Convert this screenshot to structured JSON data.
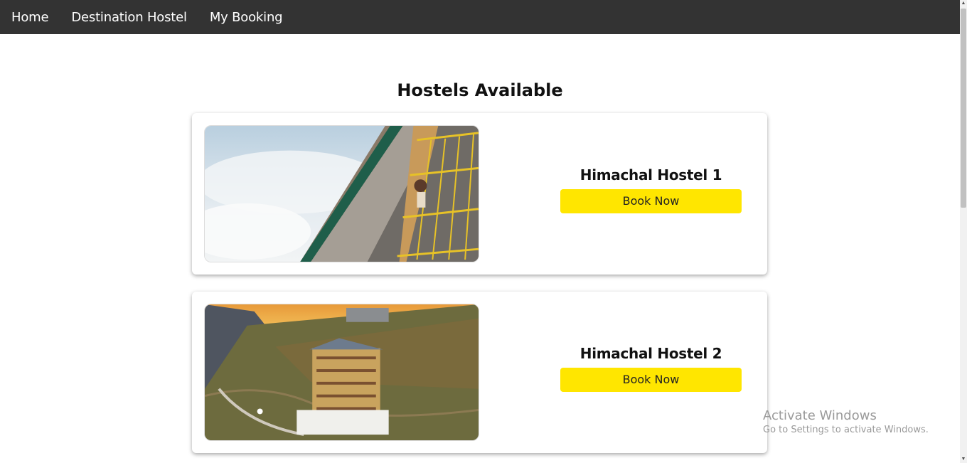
{
  "nav": {
    "items": [
      {
        "label": "Home"
      },
      {
        "label": "Destination Hostel"
      },
      {
        "label": "My Booking"
      }
    ]
  },
  "page": {
    "title": "Hostels Available"
  },
  "hostels": [
    {
      "name": "Himachal Hostel 1",
      "button": "Book Now"
    },
    {
      "name": "Himachal Hostel 2",
      "button": "Book Now"
    }
  ],
  "watermark": {
    "line1": "Activate Windows",
    "line2": "Go to Settings to activate Windows."
  },
  "colors": {
    "navbar": "#333333",
    "button": "#ffe600"
  }
}
